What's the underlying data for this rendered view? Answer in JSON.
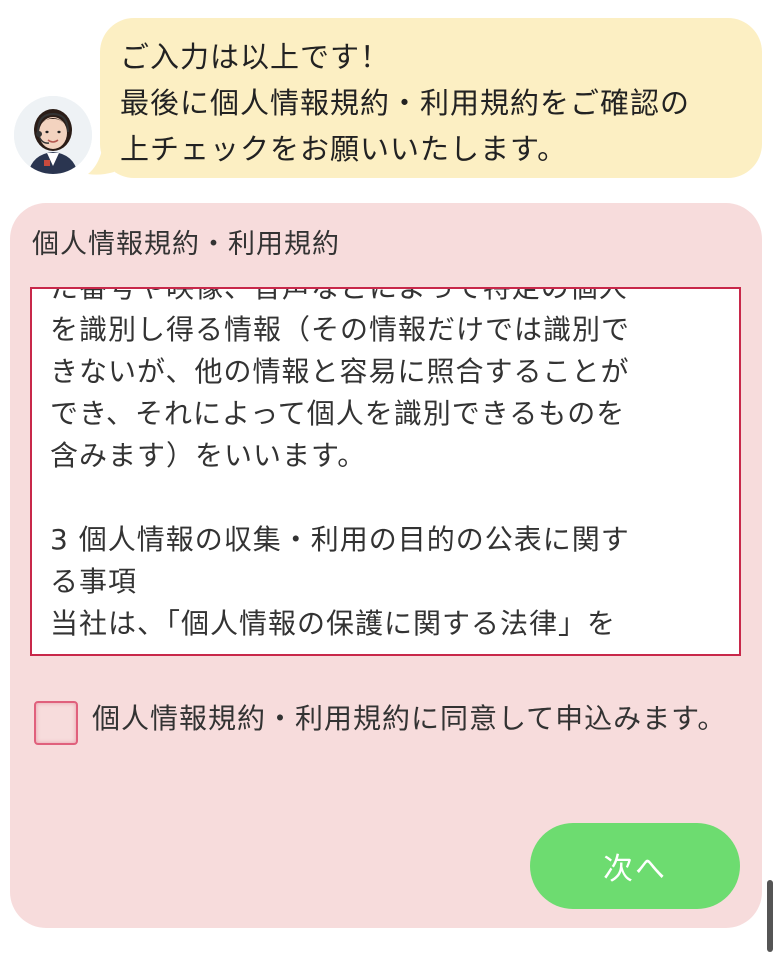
{
  "chat": {
    "avatar_icon": "operator-avatar-icon",
    "bubble_lines": [
      "ご入力は以上です！",
      "最後に個人情報規約・利用規約をご確認の",
      "上チェックをお願いいたします。"
    ],
    "bubble_color": "#fcefc3"
  },
  "panel": {
    "title": "個人情報規約・利用規約",
    "background": "#f7dcdc",
    "terms_lines": [
      "た番号や映像、音声などによって特定の個人",
      "を識別し得る情報（その情報だけでは識別で",
      "きないが、他の情報と容易に照合することが",
      "でき、それによって個人を識別できるものを",
      "含みます）をいいます。",
      "",
      "3 個人情報の収集・利用の目的の公表に関す",
      "る事項",
      "当社は、「個人情報の保護に関する法律」を"
    ],
    "terms_border_color": "#c8284a",
    "agree_label": "個人情報規約・利用規約に同意して申込みます。",
    "agree_checked": false,
    "next_button_label": "次へ",
    "next_button_color": "#6ddc70"
  }
}
